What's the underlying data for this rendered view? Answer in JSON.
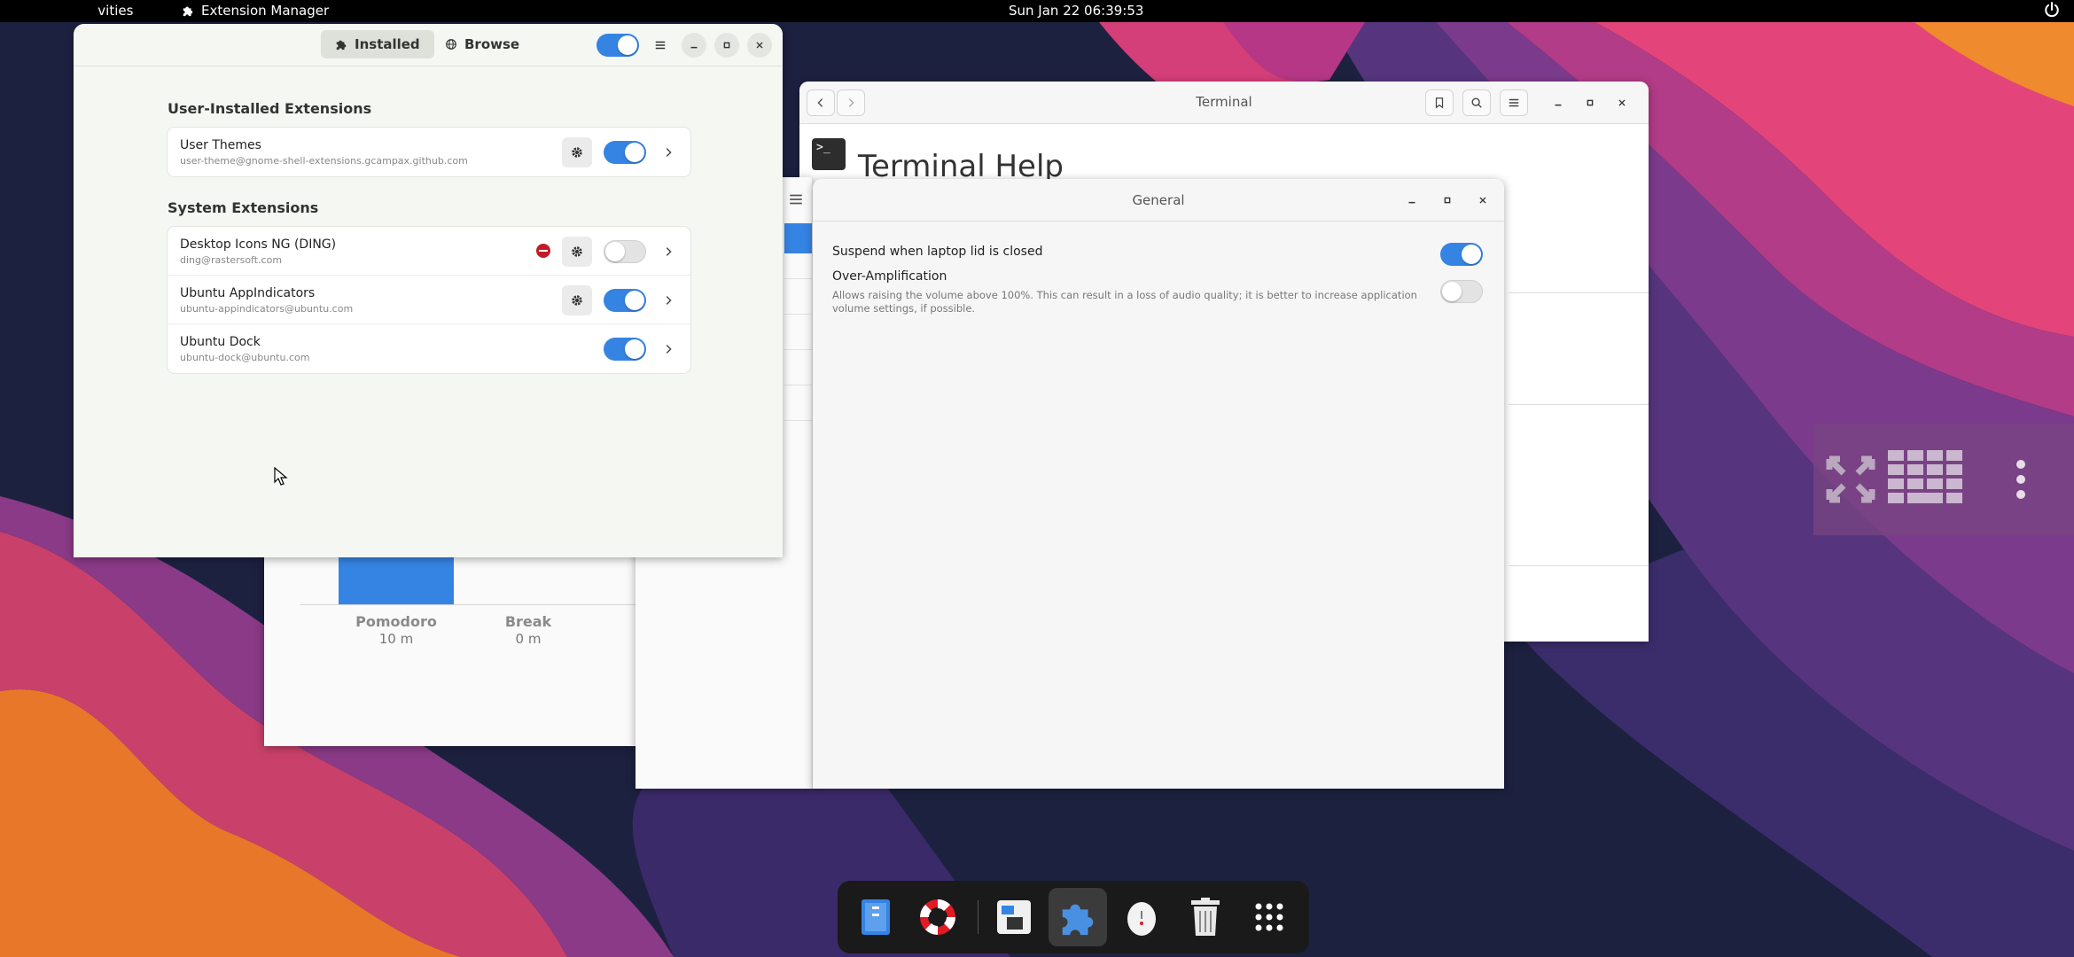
{
  "topbar": {
    "activities": "Activities",
    "app_name": "Extension Manager",
    "clock": "Sun Jan 22  06:39:53"
  },
  "pomodoro": {
    "categories": [
      "Pomodoro",
      "Break"
    ],
    "values": [
      "10 m",
      "0 m"
    ]
  },
  "terminal_help": {
    "title": "Terminal",
    "heading": "Terminal Help"
  },
  "general": {
    "title": "General",
    "suspend_label": "Suspend when laptop lid is closed",
    "suspend_on": true,
    "amp_label": "Over-Amplification",
    "amp_desc": "Allows raising the volume above 100%. This can result in a loss of audio quality; it is better to increase application volume settings, if possible.",
    "amp_on": false
  },
  "extension_manager": {
    "tabs": [
      {
        "label": "Installed",
        "icon": "puzzle-icon"
      },
      {
        "label": "Browse",
        "icon": "globe-icon"
      }
    ],
    "user_section": "User-Installed Extensions",
    "system_section": "System Extensions",
    "user_extensions": [
      {
        "name": "User Themes",
        "uuid": "user-theme@gnome-shell-extensions.gcampax.github.com",
        "enabled": true,
        "has_settings": true,
        "error": false
      }
    ],
    "system_extensions": [
      {
        "name": "Desktop Icons NG (DING)",
        "uuid": "ding@rastersoft.com",
        "enabled": false,
        "has_settings": true,
        "error": true
      },
      {
        "name": "Ubuntu AppIndicators",
        "uuid": "ubuntu-appindicators@ubuntu.com",
        "enabled": true,
        "has_settings": true,
        "error": false
      },
      {
        "name": "Ubuntu Dock",
        "uuid": "ubuntu-dock@ubuntu.com",
        "enabled": true,
        "has_settings": false,
        "error": false
      }
    ]
  },
  "dock": {
    "items": [
      "files-icon",
      "help-icon",
      "terminal-settings-icon",
      "extensions-icon",
      "egg-timer-icon",
      "trash-icon",
      "app-grid-icon"
    ]
  },
  "colors": {
    "accent": "#3584e4",
    "error": "#c01c28"
  }
}
